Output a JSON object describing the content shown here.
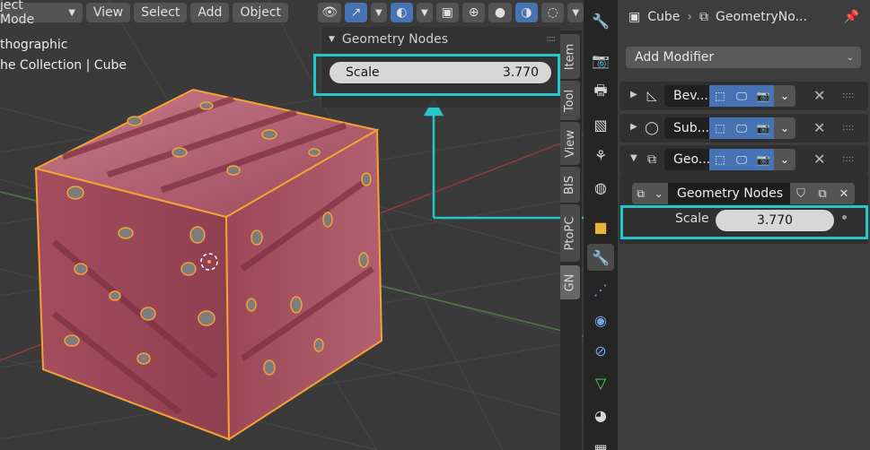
{
  "viewport": {
    "mode_label": "ject Mode",
    "menus": [
      "View",
      "Select",
      "Add",
      "Object"
    ],
    "info_view": "thographic",
    "info_collection": "he Collection | Cube",
    "n_panel": {
      "title": "Geometry Nodes",
      "field_label": "Scale",
      "field_value": "3.770"
    },
    "n_tabs": [
      "Item",
      "Tool",
      "View",
      "BIS",
      "PtoPC",
      "GN"
    ]
  },
  "properties": {
    "breadcrumb_object": "Cube",
    "breadcrumb_modifier": "GeometryNo...",
    "add_modifier_label": "Add Modifier",
    "modifiers": [
      {
        "name": "Bev...",
        "expanded": false
      },
      {
        "name": "Sub...",
        "expanded": false
      },
      {
        "name": "Geo...",
        "expanded": true
      }
    ],
    "node_group_name": "Geometry Nodes",
    "input_label": "Scale",
    "input_value": "3.770"
  },
  "colors": {
    "highlight": "#22c6cc",
    "accent_blue": "#4772b3",
    "cube_fill": "#b45a6a",
    "selection_outline": "#f3a233"
  }
}
